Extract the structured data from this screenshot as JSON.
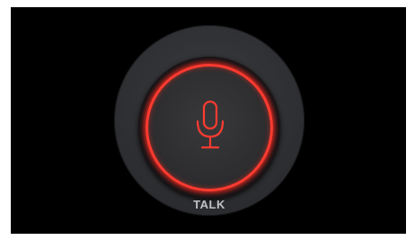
{
  "control": {
    "label": "TALK",
    "icon": "microphone-icon",
    "state": "active"
  },
  "colors": {
    "background": "#000000",
    "disc": "#2f3033",
    "accent": "#ff3b30",
    "label": "#bfc1c4"
  }
}
